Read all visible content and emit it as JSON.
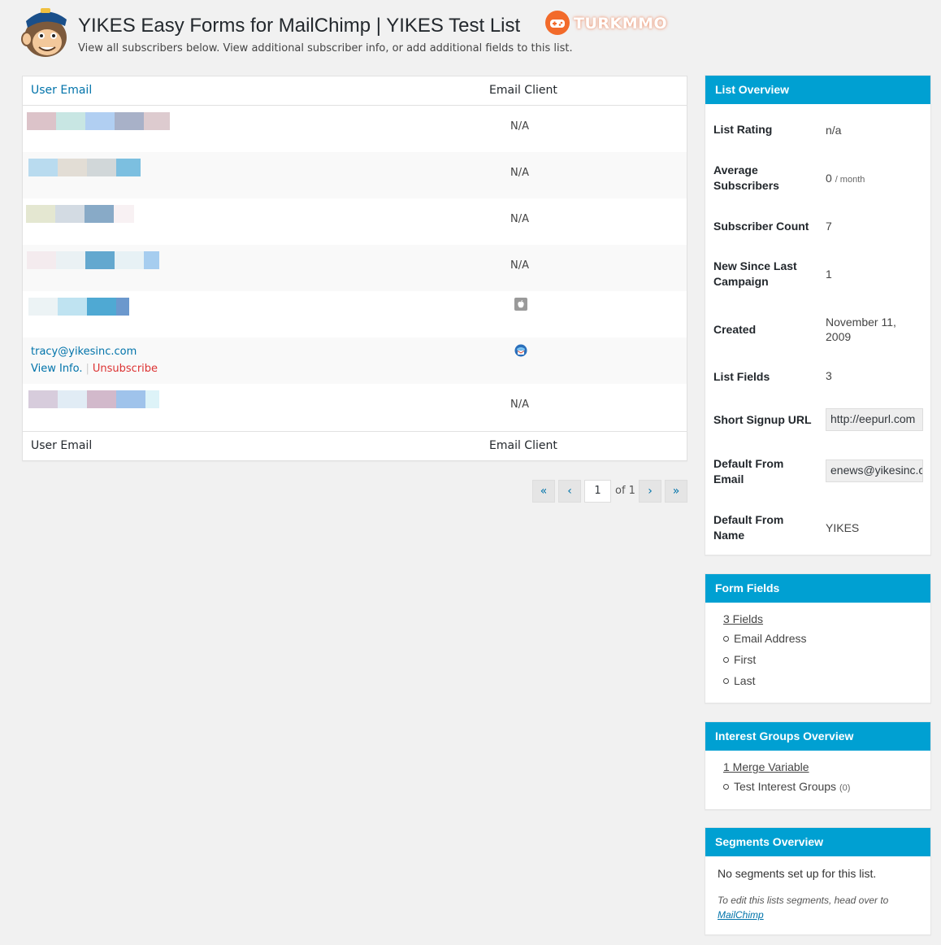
{
  "header": {
    "title": "YIKES Easy Forms for MailChimp | YIKES Test List",
    "subtitle": "View all subscribers below. View additional subscriber info, or add additional fields to this list.",
    "logo_icon": "mailchimp-monkey-logo",
    "watermark_text": "TURKMMO"
  },
  "table": {
    "col_email": "User Email",
    "col_client": "Email Client",
    "rows": [
      {
        "email": "",
        "client": "N/A",
        "blurred": true
      },
      {
        "email": "",
        "client": "N/A",
        "blurred": true
      },
      {
        "email": "",
        "client": "N/A",
        "blurred": true
      },
      {
        "email": "",
        "client": "N/A",
        "blurred": true
      },
      {
        "email": "",
        "client": "",
        "client_icon": "apple-icon",
        "blurred": true
      },
      {
        "email": "tracy@yikesinc.com",
        "client": "",
        "client_icon": "thunderbird-icon",
        "view_label": "View Info.",
        "unsubscribe_label": "Unsubscribe"
      },
      {
        "email": "",
        "client": "N/A",
        "blurred": true
      }
    ]
  },
  "pagination": {
    "first": "«",
    "prev": "‹",
    "current_page": "1",
    "of_text": "of 1",
    "next": "›",
    "last": "»"
  },
  "list_overview": {
    "title": "List Overview",
    "rating_label": "List Rating",
    "rating_value": "n/a",
    "avg_label": "Average Subscribers",
    "avg_value": "0",
    "avg_unit": "/ month",
    "count_label": "Subscriber Count",
    "count_value": "7",
    "new_label": "New Since Last Campaign",
    "new_value": "1",
    "created_label": "Created",
    "created_value": "November 11, 2009",
    "fields_label": "List Fields",
    "fields_value": "3",
    "url_label": "Short Signup URL",
    "url_value": "http://eepurl.com",
    "from_email_label": "Default From Email",
    "from_email_value": "enews@yikesinc.com",
    "from_name_label": "Default From Name",
    "from_name_value": "YIKES"
  },
  "form_fields": {
    "title": "Form Fields",
    "link": "3 Fields",
    "items": [
      "Email Address",
      "First",
      "Last"
    ]
  },
  "interest_groups": {
    "title": "Interest Groups Overview",
    "link": "1 Merge Variable",
    "item": "Test Interest Groups",
    "item_count": "(0)"
  },
  "segments": {
    "title": "Segments Overview",
    "text": "No segments set up for this list.",
    "note": "To edit this lists segments, head over to",
    "note_link": "MailChimp"
  },
  "colors": {
    "accent": "#00a0d2",
    "link": "#0073aa",
    "danger": "#dc3232"
  }
}
